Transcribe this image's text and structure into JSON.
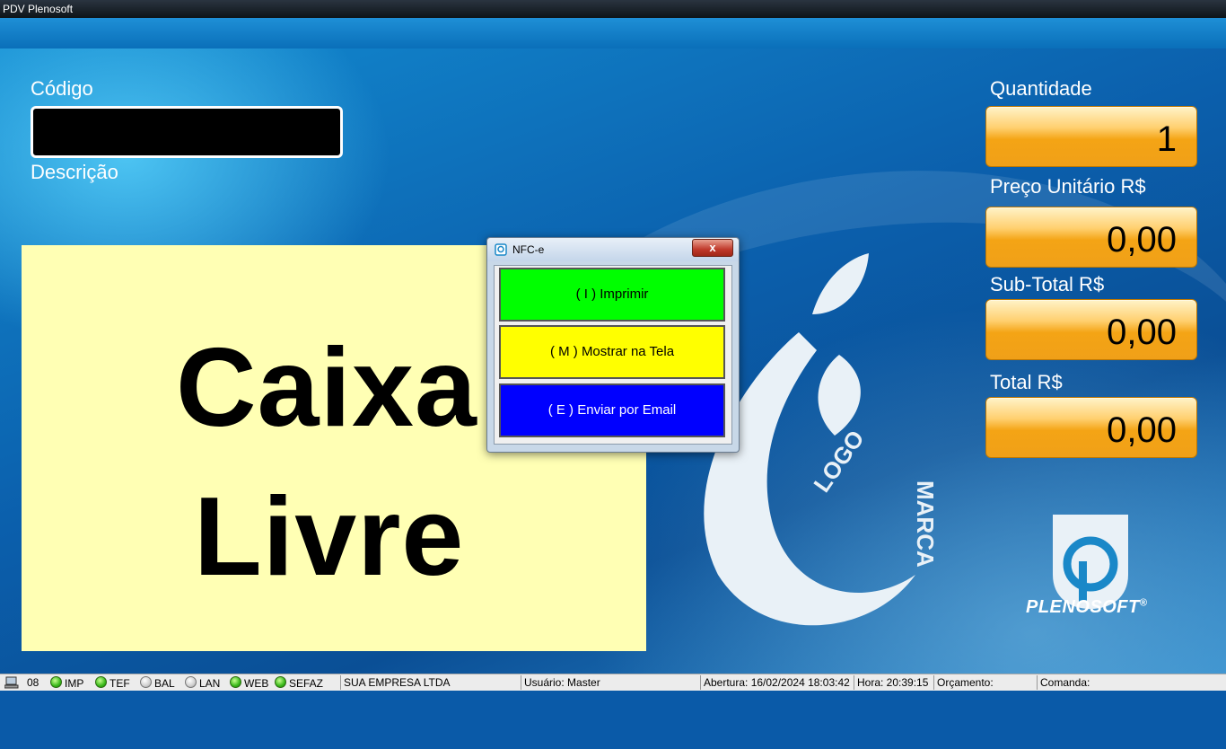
{
  "window": {
    "title": "PDV Plenosoft"
  },
  "left": {
    "codigo_label": "Código",
    "descricao_label": "Descrição",
    "status_line1": "Caixa",
    "status_line2": "Livre"
  },
  "right": {
    "quantidade_label": "Quantidade",
    "quantidade_value": "1",
    "preco_label": "Preço Unitário R$",
    "preco_value": "0,00",
    "subtotal_label": "Sub-Total R$",
    "subtotal_value": "0,00",
    "total_label": "Total R$",
    "total_value": "0,00"
  },
  "logo": {
    "text_logo": "LOGO",
    "text_marca": "MARCA",
    "brand": "PLENOSOFT",
    "brand_mark": "®"
  },
  "dialog": {
    "title": "NFC-e",
    "close_label": "x",
    "buttons": [
      {
        "label": "( I )  Imprimir",
        "color": "#00ff00",
        "text_color": "#000000"
      },
      {
        "label": "( M )  Mostrar na Tela",
        "color": "#ffff00",
        "text_color": "#000000"
      },
      {
        "label": "( E )  Enviar por Email",
        "color": "#0000ff",
        "text_color": "#ffffff"
      }
    ]
  },
  "statusbar": {
    "terminal": "08",
    "indicators": [
      {
        "label": "IMP",
        "state": "on"
      },
      {
        "label": "TEF",
        "state": "on"
      },
      {
        "label": "BAL",
        "state": "off"
      },
      {
        "label": "LAN",
        "state": "off"
      },
      {
        "label": "WEB",
        "state": "on"
      },
      {
        "label": "SEFAZ",
        "state": "on"
      }
    ],
    "empresa": "SUA EMPRESA LTDA",
    "usuario": "Usuário: Master",
    "abertura": "Abertura: 16/02/2024 18:03:42",
    "hora": "Hora: 20:39:15",
    "orcamento": "Orçamento:",
    "comanda": "Comanda:"
  }
}
